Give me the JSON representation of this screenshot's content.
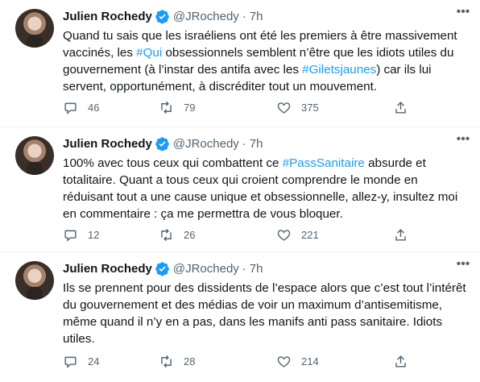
{
  "tweets": [
    {
      "author": "Julien Rochedy",
      "handle": "@JRochedy",
      "separator": "·",
      "time": "7h",
      "text_parts": [
        "Quand tu sais que les israéliens ont été les premiers à être massivement vaccinés, les ",
        "#Qui",
        " obsessionnels semblent n’être que les idiots utiles du gouvernement (à l’instar des antifa avec les ",
        "#Giletsjaunes",
        ") car ils lui servent, opportunément, à discréditer tout un mouvement."
      ],
      "replies": "46",
      "retweets": "79",
      "likes": "375"
    },
    {
      "author": "Julien Rochedy",
      "handle": "@JRochedy",
      "separator": "·",
      "time": "7h",
      "text_parts": [
        "100% avec tous ceux qui combattent ce ",
        "#PassSanitaire",
        " absurde et totalitaire. Quant a tous ceux qui croient comprendre le monde en réduisant tout a une cause unique et obsessionnelle, allez-y, insultez moi en commentaire : ça me permettra de vous bloquer."
      ],
      "replies": "12",
      "retweets": "26",
      "likes": "221"
    },
    {
      "author": "Julien Rochedy",
      "handle": "@JRochedy",
      "separator": "·",
      "time": "7h",
      "text_parts": [
        "Ils se prennent pour des dissidents de l’espace alors que c’est tout l’intérêt du gouvernement et des médias de voir un maximum d’antisemitisme, même quand il n’y en a pas, dans les manifs anti pass sanitaire. Idiots utiles."
      ],
      "replies": "24",
      "retweets": "28",
      "likes": "214"
    }
  ],
  "icons": {
    "verified": "verified-badge-icon",
    "more": "more-options-icon",
    "reply": "reply-icon",
    "retweet": "retweet-icon",
    "like": "like-icon",
    "share": "share-icon"
  },
  "colors": {
    "accent": "#1d9bf0",
    "secondary_text": "#536471",
    "divider": "#eff3f4"
  }
}
